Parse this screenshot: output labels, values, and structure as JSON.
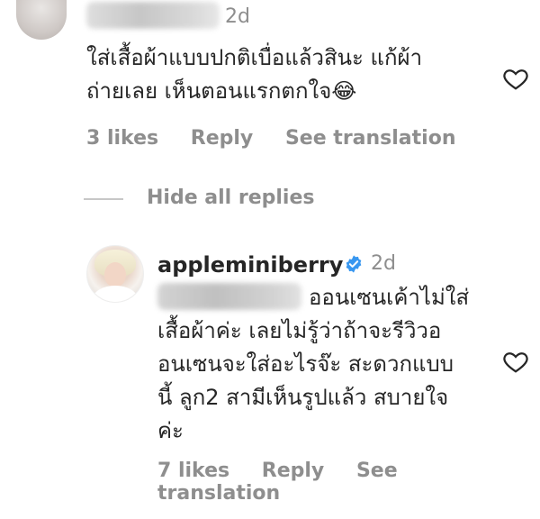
{
  "comments": [
    {
      "time": "2d",
      "lines": [
        "ใส่เสื้อผ้าแบบปกติเบื่อแล้วสินะ แก้ผ้า",
        "ถ่ายเลย เห็นตอนแรกตกใจ😂"
      ],
      "likes": "3 likes",
      "reply_label": "Reply",
      "translate_label": "See translation"
    }
  ],
  "replies_toggle": "Hide all replies",
  "replies": [
    {
      "username": "appleminiberry",
      "time": "2d",
      "lines": [
        "ออนเซนเค้าไม่ใส่",
        "เสื้อผ้าค่ะ เลยไม่รู้ว่าถ้าจะรีวิวอ",
        "อนเซนจะใส่อะไรจ๊ะ สะดวกแบบ",
        "นี้ ลูก2 สามีเห็นรูปแล้ว สบายใจ",
        "ค่ะ"
      ],
      "likes": "7 likes",
      "reply_label": "Reply",
      "translate_label": "See translation"
    }
  ],
  "colors": {
    "text": "#262626",
    "muted": "#8e8e8e",
    "verified": "#3897f0"
  },
  "icons": [
    "heart-icon",
    "verified-badge-icon"
  ]
}
